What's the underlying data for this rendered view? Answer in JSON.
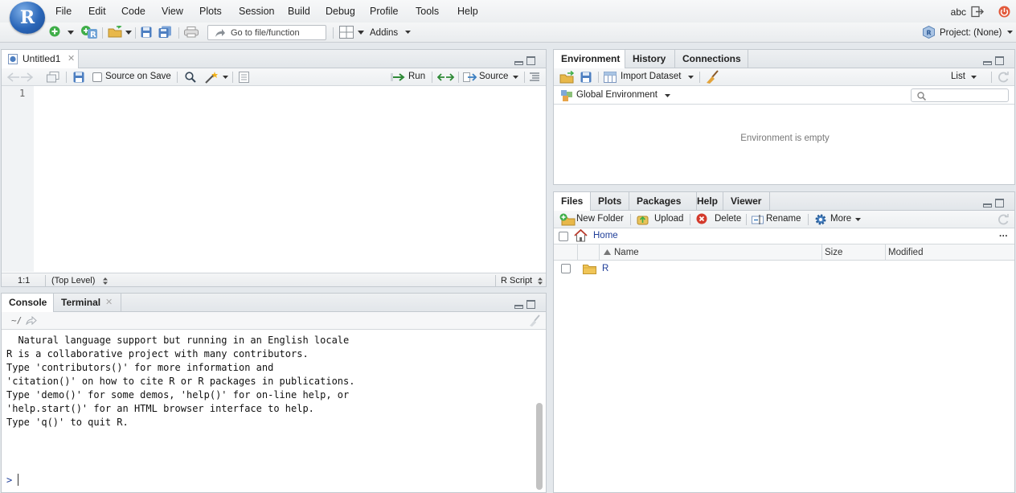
{
  "menubar": {
    "logo_letter": "R",
    "items": [
      "File",
      "Edit",
      "Code",
      "View",
      "Plots",
      "Session",
      "Build",
      "Debug",
      "Profile",
      "Tools",
      "Help"
    ],
    "user": "abc"
  },
  "toolbar": {
    "goto_placeholder": "Go to file/function",
    "addins_label": "Addins",
    "project_label": "Project: (None)"
  },
  "source_pane": {
    "tab_label": "Untitled1",
    "source_on_save_label": "Source on Save",
    "run_label": "Run",
    "source_label": "Source",
    "line_number": "1",
    "status_position": "1:1",
    "status_scope": "(Top Level)",
    "status_filetype": "R Script"
  },
  "console_pane": {
    "tabs": [
      "Console",
      "Terminal"
    ],
    "path": "~/",
    "lines": [
      "  Natural language support but running in an English locale",
      "",
      "R is a collaborative project with many contributors.",
      "Type 'contributors()' for more information and",
      "'citation()' on how to cite R or R packages in publications.",
      "",
      "Type 'demo()' for some demos, 'help()' for on-line help, or",
      "'help.start()' for an HTML browser interface to help.",
      "Type 'q()' to quit R.",
      ""
    ],
    "prompt": ">"
  },
  "environment_pane": {
    "tabs": [
      "Environment",
      "History",
      "Connections"
    ],
    "import_dataset_label": "Import Dataset",
    "list_label": "List",
    "scope_label": "Global Environment",
    "empty_message": "Environment is empty"
  },
  "files_pane": {
    "tabs": [
      "Files",
      "Plots",
      "Packages",
      "Help",
      "Viewer"
    ],
    "new_folder_label": "New Folder",
    "upload_label": "Upload",
    "delete_label": "Delete",
    "rename_label": "Rename",
    "more_label": "More",
    "breadcrumb_home": "Home",
    "columns": [
      "Name",
      "Size",
      "Modified"
    ],
    "rows": [
      {
        "name": "R",
        "size": "",
        "modified": ""
      }
    ]
  }
}
